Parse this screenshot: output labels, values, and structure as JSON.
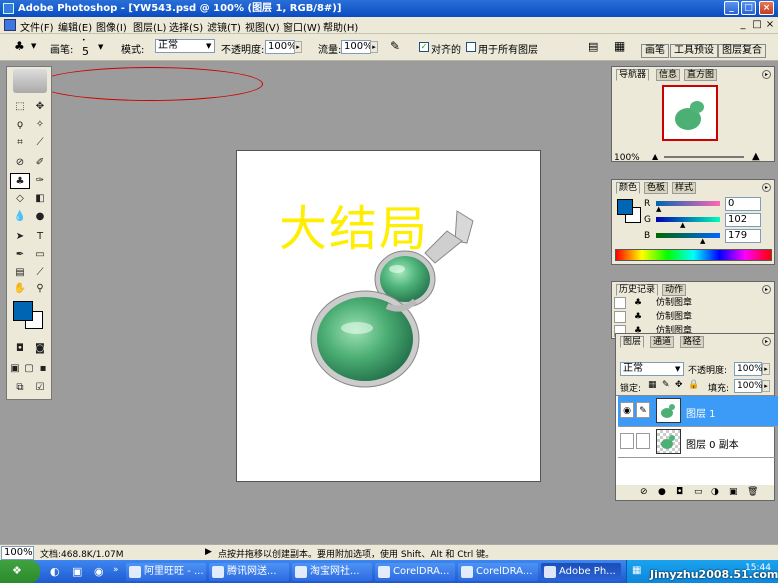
{
  "window": {
    "title": "Adobe Photoshop - [YW543.psd @ 100% (图层 1, RGB/8#)]",
    "min": "_",
    "max": "□",
    "close": "×"
  },
  "menu": {
    "items": [
      "文件(F)",
      "编辑(E)",
      "图像(I)",
      "图层(L)",
      "选择(S)",
      "滤镜(T)",
      "视图(V)",
      "窗口(W)",
      "帮助(H)"
    ],
    "mdi": [
      "_",
      "□",
      "×"
    ]
  },
  "options": {
    "brush_label": "画笔:",
    "brush_size": "5",
    "mode_label": "模式:",
    "mode_value": "正常",
    "opacity_label": "不透明度:",
    "opacity_value": "100%",
    "flow_label": "流量:",
    "flow_value": "100%",
    "aligned_label": "对齐的",
    "all_layers_label": "用于所有图层",
    "well_tabs": [
      "画笔",
      "工具预设",
      "图层复合"
    ]
  },
  "document": {
    "text": "大结局"
  },
  "navigator": {
    "tabs": [
      "导航器",
      "信息",
      "直方图"
    ],
    "zoom": "100%"
  },
  "color": {
    "tabs": [
      "颜色",
      "色板",
      "样式"
    ],
    "channels": [
      {
        "name": "R",
        "value": "0"
      },
      {
        "name": "G",
        "value": "102"
      },
      {
        "name": "B",
        "value": "179"
      }
    ],
    "fg_color": "#0066b3"
  },
  "history": {
    "tabs": [
      "历史记录",
      "动作"
    ],
    "rows": [
      "仿制图章",
      "仿制图章",
      "仿制图章"
    ]
  },
  "layers": {
    "tabs": [
      "图层",
      "通道",
      "路径"
    ],
    "mode": "正常",
    "opacity_label": "不透明度:",
    "opacity_value": "100%",
    "lock_label": "锁定:",
    "fill_label": "填充:",
    "fill_value": "100%",
    "rows": [
      {
        "name": "图层 1"
      },
      {
        "name": "图层 0 副本"
      }
    ]
  },
  "status": {
    "zoom": "100%",
    "doc": "文档:468.8K/1.07M",
    "hint": "点按并拖移以创建副本。要用附加选项，使用 Shift、Alt 和 Ctrl 键。"
  },
  "taskbar": {
    "buttons": [
      "阿里旺旺 - ...",
      "腾讯网送...",
      "淘宝网社...",
      "CorelDRA...",
      "CorelDRA...",
      "Adobe Ph..."
    ],
    "clock": "15:44",
    "watermark": "Jimyzhu2008.51.com"
  }
}
